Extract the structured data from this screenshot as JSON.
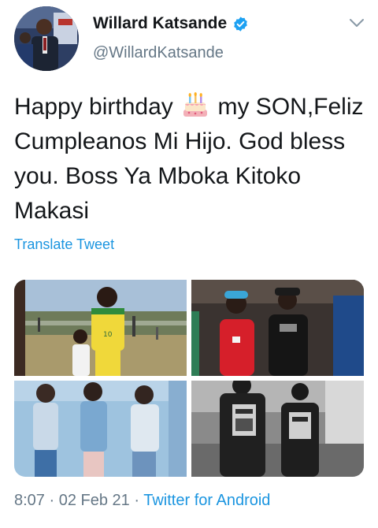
{
  "user": {
    "display_name": "Willard Katsande",
    "handle": "@WillardKatsande",
    "verified": true
  },
  "tweet": {
    "text_before_emoji": "Happy birthday",
    "emoji": "birthday-cake",
    "text_after_emoji": "my SON,Feliz Cumpleanos Mi Hijo. God bless you. Boss Ya Mboka Kitoko Makasi",
    "translate_label": "Translate Tweet",
    "media_count": 4,
    "jersey_number": "10"
  },
  "meta": {
    "time": "8:07",
    "separator_1": "·",
    "date": "02 Feb 21",
    "separator_2": "·",
    "source": "Twitter for Android"
  },
  "colors": {
    "link": "#1b95e0",
    "secondary_text": "#657786",
    "primary_text": "#14171a",
    "verified_badge": "#1da1f2"
  }
}
